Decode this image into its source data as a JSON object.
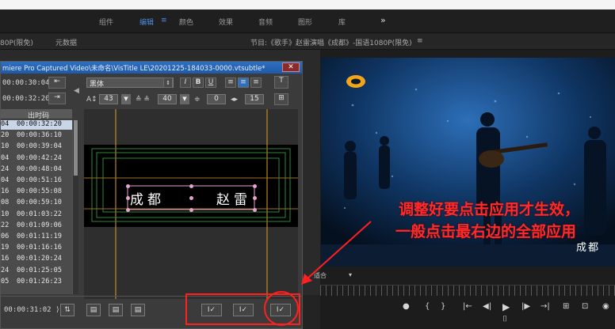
{
  "workspaces": [
    "组件",
    "编辑",
    "颜色",
    "效果",
    "音频",
    "图形",
    "库",
    "»"
  ],
  "active_workspace": "编辑",
  "section": {
    "source_tab": "80P(限免)",
    "metadata_tab": "元数据",
    "program_title": "节目:《歌手》赵雷演唱《成都》-国语1080P(限免)",
    "menu_glyph": "≡"
  },
  "dialog": {
    "title": "miere Pro Captured Video\\未命名\\VisTitle LE\\20201225-184033-0000.vtsubtle*",
    "close": "✕",
    "tc1": "00:00:30:04 ⟩",
    "tc2": "00:00:32:20 ⟩",
    "font": "黑体",
    "size1": "43",
    "size2": "40",
    "num3": "0",
    "num4": "15",
    "style_italic": "I",
    "style_bold": "B",
    "style_underline": "U",
    "table_header": "出时码",
    "rows": [
      {
        "a": "04",
        "b": "00:00:32:20"
      },
      {
        "a": "20",
        "b": "00:00:36:10"
      },
      {
        "a": "10",
        "b": "00:00:39:04"
      },
      {
        "a": "04",
        "b": "00:00:42:24"
      },
      {
        "a": "24",
        "b": "00:00:48:04"
      },
      {
        "a": "04",
        "b": "00:00:51:16"
      },
      {
        "a": "16",
        "b": "00:00:55:08"
      },
      {
        "a": "08",
        "b": "00:00:59:10"
      },
      {
        "a": "10",
        "b": "00:01:03:22"
      },
      {
        "a": "22",
        "b": "00:01:09:06"
      },
      {
        "a": "06",
        "b": "00:01:11:19"
      },
      {
        "a": "19",
        "b": "00:01:16:16"
      },
      {
        "a": "16",
        "b": "00:01:20:24"
      },
      {
        "a": "24",
        "b": "00:01:25:05"
      },
      {
        "a": "05",
        "b": "00:01:26:23"
      }
    ],
    "subtitle_left": "成都",
    "subtitle_right": "赵雷",
    "bottom_tc": "00:00:31:02 ⟩",
    "apply_labels": [
      "I✓",
      "I✓",
      "I✓"
    ]
  },
  "video": {
    "overlay_subtitle": "成都"
  },
  "annotation": {
    "line1": "调整好要点击应用才生效，",
    "line2": "一般点击最右边的全部应用"
  },
  "program_controls": {
    "fit_label": "适合",
    "glyphs": [
      "▾",
      "{",
      "}",
      "|←",
      "◀|",
      "▶",
      "|▶",
      "→|",
      "⊞",
      "⊡",
      "⌷"
    ]
  },
  "colors": {
    "active_ws": "#4c8ddf",
    "annotation": "#ff2b2b",
    "title_bar": "#2f6fbf"
  }
}
